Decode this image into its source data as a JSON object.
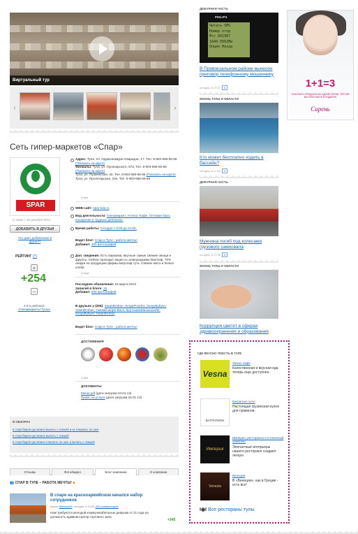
{
  "video": {
    "caption": "Виртуальный тур"
  },
  "page_title": "Сеть гипер-маркетов «Спар»",
  "logo_text": "SPAR",
  "profile": {
    "since": "С нами с 15 декабря 2011",
    "add_friends": "ДОБАВИТЬ В ДРУЗЬЯ",
    "what_gives": "Что дает добавление в друзья?",
    "rating_label": "РЕЙТИНГ",
    "rating_link": "(?)",
    "plus": "+",
    "minus": "–",
    "score": "+254",
    "rank_text": "2-й в рейтинге",
    "rank_link": "«Гипермаркеты Тулы»"
  },
  "info": {
    "address_label": "Адрес:",
    "address_text": "Тула, Ул. Орджоникидзе-Свиридзе, 17. Тел. 8-903-666-66-66",
    "address_map": "(Показать на карте)",
    "branches_label": "Филиалы:",
    "branches_text": "Тула, ул. Луначарского, 67а, Тел. 8-903-666-66-66",
    "branch2": "Тула, ул. Пушкинская, 32, Тел. 8-903-666-66-66",
    "branch3": "Тула, ул. Пролетарская, 22е, Тел. 8-903-666-66-66",
    "show_map": "(Показать на карте)",
    "all_label": "все",
    "web_label": "WEB-сайт:",
    "web_value": "spar-tula.ru",
    "activity_label": "Вид деятельности:",
    "activity_value": "Гипермаркет, Аптека, Кафе, Оптовая база, поседение в трудных делишках.",
    "hours_label": "Время работы:",
    "hours_value": "Сегодня с 8:00 до 21:00.",
    "blog_label": "Ведет блог:",
    "blog_value": "Спар в Туле - работа мечты!",
    "added_label": "Добавил:",
    "added_value": "300 фотографий",
    "extra_label": "Доп. сведения:",
    "extra_value": "Есть парковка, вкусные самые свежие овощи и фрукты. Сейчас проходит акция со сковородками бергхоф. 70% скидка на продукцию фирмы Бергхоф тута. Свежее мясо и белые хлеба",
    "more_label": "еще",
    "last_update_label": "Последнее обновление:",
    "last_update_value": "23 марта 2012",
    "posts_label": "Записей в блоге:",
    "posts_value": "15",
    "added2_label": "Добавил:",
    "added2_value": "300 фотографий",
    "friends_label": "В друзьях у (255):",
    "friends_value": "SatanBroban, SergeiPuzdov, SvayyBybyev, SatanBroban, Свежий морж Вася, КрутышкаМалышкаЯя, SvayyBybyev, SatanBroban",
    "blog2_label": "Ведет блог:",
    "blog2_value": "Спар в Туле - работа мечты!",
    "achievements_label": "ДОСТИЖЕНИЯ",
    "all2_label": "все",
    "docs_label": "ДОКУМЕНТЫ",
    "doc1_link": "Меню.pdf",
    "doc1_meta": "(дата загрузки 24.01.13)",
    "doc2_link": "Прайс на услуги",
    "doc2_meta": "(дата загрузки 24.01.13)"
  },
  "reviews": {
    "heading": "В ОБЗОРАХ",
    "items": [
      "6 спортбаров где можно выпить с семьёй и не отвалить по шее",
      "6 спортбаров где можно выпить с семьёй",
      "6 спортбаров где можно отвалить по шее и выпить с семьёй"
    ]
  },
  "tabs": [
    "Отзывы",
    "Фото/видео",
    "Блог компании",
    "О компании"
  ],
  "blog": {
    "heading": "СПАР В ТУЛЕ – РАБОТА МЕЧТЫ!",
    "post_title": "В спаре на красноармейском начался набор сотрудников",
    "post_meta_author": "Warlock29",
    "post_meta_date": "сегодня, в 13:35",
    "post_meta_comments": "(33) комментария",
    "post_meta_prefix": "пишет",
    "post_text": "Нам требуются молодой коммуникабельные девушки от 21 года на должность администратор торгового зала.",
    "post_rating": "+345"
  },
  "news": [
    {
      "category": "ДЕЖУРНАЯ ЧАСТЬ",
      "title": "В Привокзальном районе вынесен приговор телефонному мошеннику",
      "meta": "сегодня, в 17:57",
      "count": "0"
    },
    {
      "category": "ЖИЗНЬ ТУЛЫ И ОБЛАСТИ",
      "title": "Кто может бесплатно ходить в бассейн?",
      "meta": "сегодня, в 17:52",
      "count": "0"
    },
    {
      "category": "ДЕЖУРНАЯ ЧАСТЬ",
      "title": "Мужчина погиб под колесами грузового самосвала",
      "meta": "сегодня, в 17:36",
      "count": "0"
    },
    {
      "category": "ЖИЗНЬ ТУЛЫ И ОБЛАСТИ",
      "title": "Коррупция цветет в сферах здравоохранения и образования",
      "meta": "",
      "count": ""
    }
  ],
  "phone_screen": [
    "Читать SMS",
    "Номер отпр",
    "Мтс 891987",
    "1640 0902Ми",
    "Опция",
    "Назад"
  ],
  "phone_brand": "PHILIPS",
  "restaurants": {
    "heading": "ГДЕ ВКУСНО ПОЕСТЬ В ТУЛЕ",
    "items": [
      {
        "logo": "Vesna",
        "name": "Vesna, кафе",
        "desc": "Качественная и вкусная еда теперь еще доступнее."
      },
      {
        "logo": "БАГРАТИОН",
        "name": "Багратион холл",
        "desc": "Настоящая грузинская кухня для гурманов."
      },
      {
        "logo": "Империя",
        "name": "Империя, ресторанно-гостиничный комплекс",
        "desc": "Элегантные интерьеры нашего ресторано создают легкую"
      },
      {
        "logo": "Venezia",
        "name": "Венеция",
        "desc": "В «Венеции», как в Греции - есть все!"
      }
    ],
    "all_link": "Все рестораны тулы"
  },
  "ad": {
    "promo": "1+1=3",
    "sub": "ПОКУПАЯ 2 ПРОДУКТА ИЗ ОДНОЙ СЕРИИ, ТРЕТИЙ ВЫ ПОЛУЧАЕТЕ В ПОДАРОК",
    "brand": "Сирень"
  },
  "colors": {
    "accent": "#1a6bb5",
    "spar_red": "#d71920",
    "spar_green": "#1f8e3d",
    "rating_green": "#3a9a2a",
    "dotted_border": "#c0117f"
  }
}
